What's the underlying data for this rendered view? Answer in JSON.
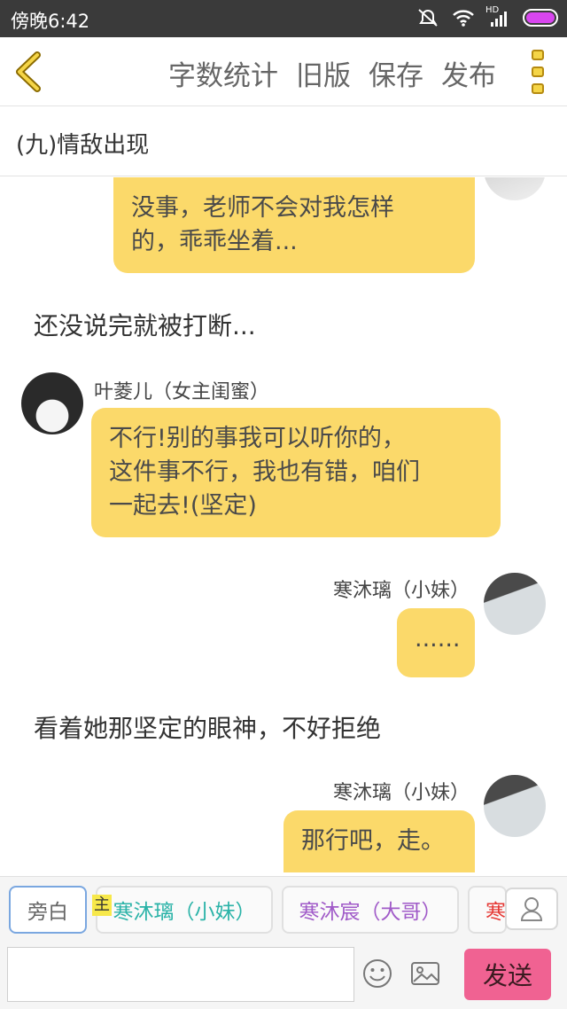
{
  "status_bar": {
    "time": "傍晚6:42",
    "network": "HD",
    "icons": [
      "mute-icon",
      "wifi-icon",
      "signal-icon",
      "battery-icon"
    ],
    "battery_color": "#d946ef"
  },
  "toolbar": {
    "back_icon": "chevron-left-icon",
    "word_count": "字数统计",
    "old_version": "旧版",
    "save": "保存",
    "publish": "发布",
    "more_icon": "more-menu-icon",
    "accent": "#f5d547"
  },
  "chapter": {
    "title": "(九)情敌出现"
  },
  "messages": [
    {
      "type": "bubble",
      "side": "right",
      "text_line1": "没事，老师不会对我怎样",
      "text_line2": "的，乖乖坐着..."
    },
    {
      "type": "narration",
      "text": "还没说完就被打断..."
    },
    {
      "type": "bubble",
      "side": "left",
      "name": "叶菱儿（女主闺蜜）",
      "text_line1": "不行!别的事我可以听你的，",
      "text_line2": "这件事不行，我也有错，咱们",
      "text_line3": "一起去!(坚定)"
    },
    {
      "type": "bubble",
      "side": "right",
      "name": "寒沐璃（小妹）",
      "text_line1": "......"
    },
    {
      "type": "narration",
      "text": "看着她那坚定的眼神，不好拒绝"
    },
    {
      "type": "bubble",
      "side": "right",
      "name": "寒沐璃（小妹）",
      "text_line1": "那行吧，走。"
    }
  ],
  "bubble_color": "#fbd96a",
  "characters": {
    "narrator": "旁白",
    "main_tag": "主",
    "char1": "寒沐璃（小妹）",
    "char1_color": "#2bb3a8",
    "char2": "寒沐宸（大哥）",
    "char2_color": "#a05ac8",
    "char3_partial": "寒",
    "char3_color": "#e53935",
    "add_icon": "person-icon"
  },
  "input": {
    "placeholder": "",
    "emoji_icon": "emoji-icon",
    "image_icon": "image-icon",
    "send_label": "发送",
    "send_color": "#f06292"
  }
}
